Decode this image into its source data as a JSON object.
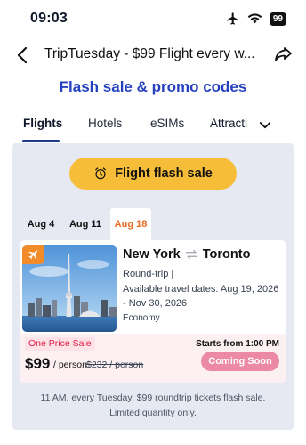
{
  "status": {
    "time": "09:03",
    "battery": "99",
    "icons": [
      "airplane-icon",
      "wifi-icon",
      "battery-icon"
    ]
  },
  "nav": {
    "title": "TripTuesday - $99 Flight every w...",
    "back_icon": "chevron-left-icon",
    "share_icon": "share-icon"
  },
  "heading": "Flash sale & promo codes",
  "tabs": [
    {
      "label": "Flights",
      "active": true
    },
    {
      "label": "Hotels",
      "active": false
    },
    {
      "label": "eSIMs",
      "active": false
    },
    {
      "label": "Attracti",
      "active": false
    }
  ],
  "tabs_expand_icon": "chevron-down-icon",
  "flash_button": {
    "label": "Flight flash sale",
    "icon": "alarm-clock-icon"
  },
  "date_tabs": [
    {
      "label": "Aug 4",
      "active": false
    },
    {
      "label": "Aug 11",
      "active": false
    },
    {
      "label": "Aug 18",
      "active": true
    }
  ],
  "deal": {
    "origin": "New York",
    "destination": "Toronto",
    "route_icon": "round-trip-arrows-icon",
    "trip_type": "Round-trip |",
    "dates_label": "Available travel dates:",
    "dates_start": "Aug 19, 2026",
    "dates_sep": "-",
    "dates_end": "Nov 30, 2026",
    "cabin": "Economy",
    "badge_icon": "plane-icon",
    "tag": "One Price Sale",
    "price": "$99",
    "price_unit": "/ person",
    "old_price": "$232 / person",
    "starts_from": "Starts from 1:00 PM",
    "cta": "Coming Soon"
  },
  "footnote": {
    "line1": "11 AM, every Tuesday, $99 roundtrip tickets flash sale.",
    "line2": "Limited quantity only."
  },
  "colors": {
    "heading": "#2541c0",
    "flash_button": "#f6bd38",
    "active_date": "#e86a1f",
    "badge": "#f28c28",
    "sale_tag": "#e11d48",
    "cta": "#ec8aa6"
  }
}
